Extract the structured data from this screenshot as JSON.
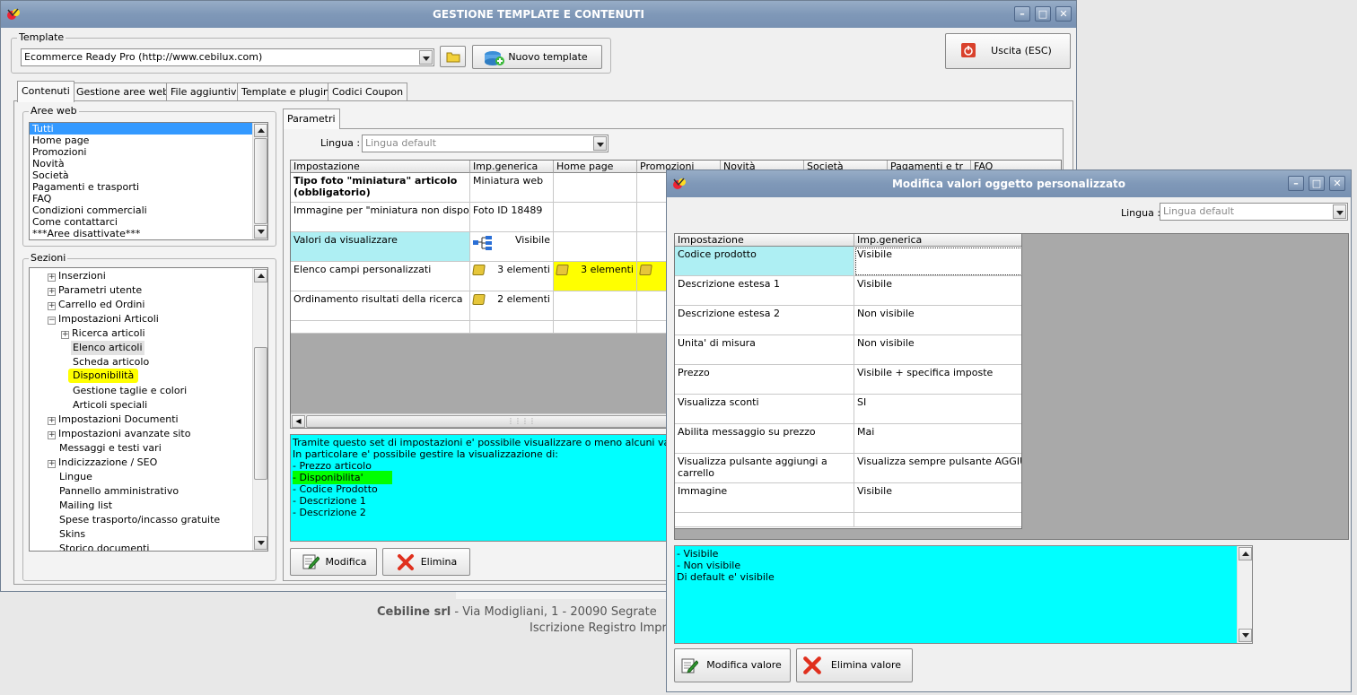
{
  "main_window": {
    "title": "GESTIONE TEMPLATE E CONTENUTI",
    "template_group_label": "Template",
    "template_select_value": "Ecommerce Ready Pro (http://www.cebilux.com)",
    "new_template_label": "Nuovo template",
    "exit_label": "Uscita (ESC)",
    "tabs": [
      {
        "label": "Contenuti"
      },
      {
        "label": "Gestione aree web"
      },
      {
        "label": "File aggiuntivi"
      },
      {
        "label": "Template e plugins"
      },
      {
        "label": "Codici Coupon"
      }
    ],
    "aree_web_label": "Aree web",
    "aree_web_items": [
      "Tutti",
      "Home page",
      "Promozioni",
      "Novità",
      "Società",
      "Pagamenti e trasporti",
      "FAQ",
      "Condizioni commerciali",
      "Come contattarci",
      "***Aree disattivate***"
    ],
    "sezioni_label": "Sezioni",
    "sezioni_items": [
      {
        "label": "Inserzioni"
      },
      {
        "label": "Parametri utente"
      },
      {
        "label": "Carrello ed Ordini"
      },
      {
        "label": "Impostazioni Articoli"
      },
      {
        "label": "Ricerca articoli"
      },
      {
        "label": "Elenco articoli"
      },
      {
        "label": "Scheda articolo"
      },
      {
        "label": "Disponibilità"
      },
      {
        "label": "Gestione taglie e colori"
      },
      {
        "label": "Articoli speciali"
      },
      {
        "label": "Impostazioni Documenti"
      },
      {
        "label": "Impostazioni avanzate sito"
      },
      {
        "label": "Messaggi e testi vari"
      },
      {
        "label": "Indicizzazione / SEO"
      },
      {
        "label": "Lingue"
      },
      {
        "label": "Pannello amministrativo"
      },
      {
        "label": "Mailing list"
      },
      {
        "label": "Spese trasporto/incasso gratuite"
      },
      {
        "label": "Skins"
      },
      {
        "label": "Storico documenti"
      }
    ],
    "parametri_tab": "Parametri",
    "lingua_label": "Lingua :",
    "lingua_value": "Lingua default",
    "grid_headers": [
      "Impostazione",
      "Imp.generica",
      "Home page",
      "Promozioni",
      "Novità",
      "Società",
      "Pagamenti e tr",
      "FAQ"
    ],
    "grid_rows": [
      {
        "name": "Tipo foto \"miniatura\" articolo (obbligatorio)",
        "generic": "Miniatura web",
        "home": ""
      },
      {
        "name": "Immagine per \"miniatura non disponibile\"",
        "generic": "Foto ID 18489",
        "home": ""
      },
      {
        "name": "Valori da visualizzare",
        "generic": "Visibile",
        "home": ""
      },
      {
        "name": "Elenco campi personalizzati",
        "generic": "3 elementi",
        "home": "3 elementi"
      },
      {
        "name": "Ordinamento risultati della ricerca",
        "generic": "2 elementi",
        "home": ""
      }
    ],
    "description_lines": [
      "Tramite questo set di impostazioni e' possibile visualizzare o meno alcuni valori nella lista",
      "In particolare e' possibile gestire la visualizzazione di:",
      "- Prezzo articolo",
      "- Disponibilita'",
      "- Codice Prodotto",
      "- Descrizione 1",
      "- Descrizione 2"
    ],
    "modifica_label": "Modifica",
    "elimina_label": "Elimina"
  },
  "footer": {
    "company": "Cebiline srl",
    "address": " - Via Modigliani, 1 - 20090 Segrate",
    "registry": "Iscrizione Registro Impr"
  },
  "dialog": {
    "title": "Modifica valori oggetto personalizzato",
    "lingua_label": "Lingua :",
    "lingua_value": "Lingua default",
    "grid_headers": [
      "Impostazione",
      "Imp.generica"
    ],
    "rows": [
      {
        "name": "Codice prodotto",
        "value": "Visibile"
      },
      {
        "name": "Descrizione estesa 1",
        "value": "Visibile"
      },
      {
        "name": "Descrizione estesa 2",
        "value": "Non visibile"
      },
      {
        "name": "Unita' di misura",
        "value": "Non visibile"
      },
      {
        "name": "Prezzo",
        "value": "Visibile + specifica imposte"
      },
      {
        "name": "Visualizza sconti",
        "value": "SI"
      },
      {
        "name": "Abilita messaggio su prezzo",
        "value": "Mai"
      },
      {
        "name": "Visualizza pulsante aggiungi a carrello",
        "value": "Visualizza sempre pulsante AGGIUNGI"
      },
      {
        "name": "Immagine",
        "value": "Visibile"
      }
    ],
    "memo_lines": [
      "- Visibile",
      "- Non visibile",
      "Di default e' visibile"
    ],
    "modifica_valore_label": "Modifica valore",
    "elimina_valore_label": "Elimina valore"
  },
  "colors": {
    "title_bar": "#7f98b8",
    "selection": "#3399ff",
    "highlight_cyan": "#00ffff",
    "highlight_yellow": "#ffff00",
    "highlight_green": "#00ff00",
    "cell_highlight": "#aeeff3"
  }
}
